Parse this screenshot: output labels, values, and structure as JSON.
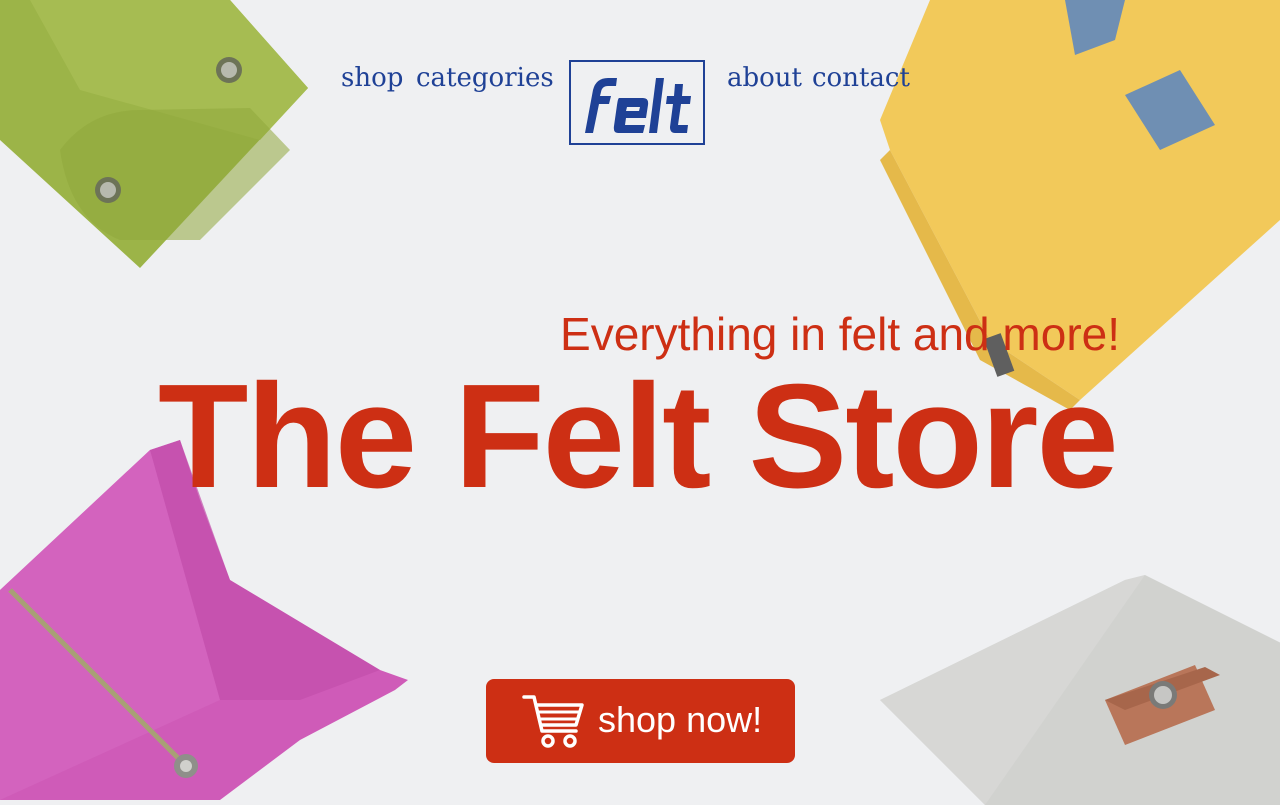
{
  "nav": {
    "shop": "shop",
    "categories": "categories",
    "about": "about",
    "contact": "contact",
    "logo_text": "felt"
  },
  "hero": {
    "tagline": "Everything in felt and more!",
    "title": "The Felt Store",
    "cta_label": "shop now!",
    "cta_icon": "shopping-cart-icon"
  },
  "colors": {
    "background": "#eff0f2",
    "brand_blue": "#1f4196",
    "accent_red": "#cd2f14",
    "felt_green": "#9bb346",
    "felt_yellow": "#f4cd5a",
    "felt_pink": "#cf5ab8",
    "felt_grey": "#cfd0cd"
  }
}
